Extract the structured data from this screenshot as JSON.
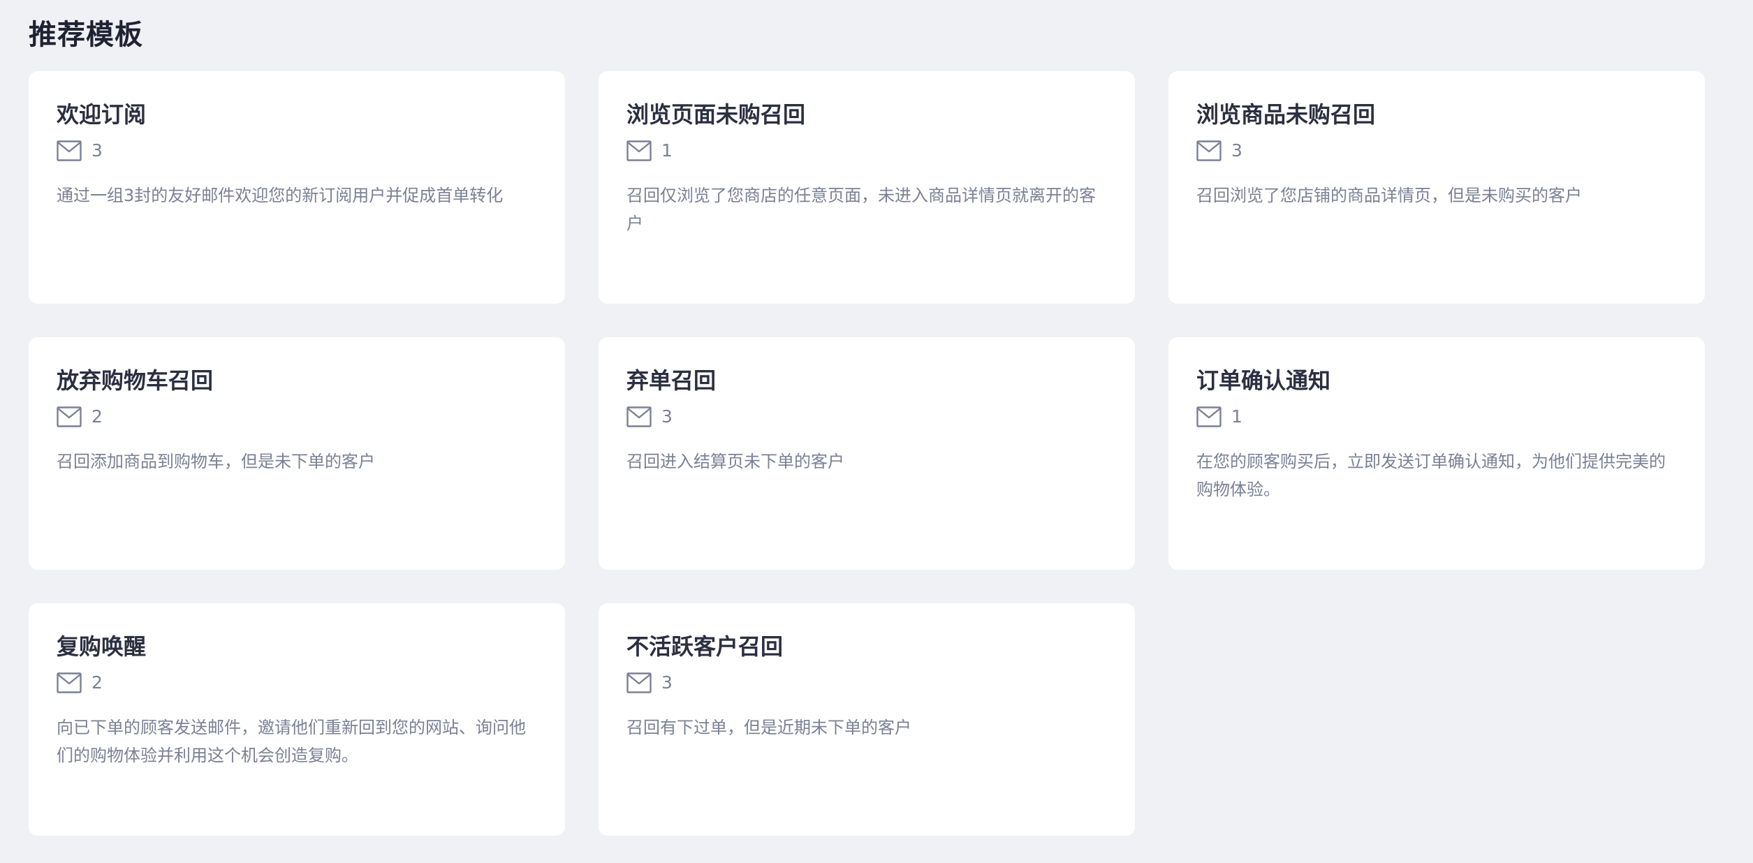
{
  "page": {
    "title": "推荐模板"
  },
  "templates": [
    {
      "title": "欢迎订阅",
      "count": "3",
      "description": "通过一组3封的友好邮件欢迎您的新订阅用户并促成首单转化"
    },
    {
      "title": "浏览页面未购召回",
      "count": "1",
      "description": "召回仅浏览了您商店的任意页面，未进入商品详情页就离开的客户"
    },
    {
      "title": "浏览商品未购召回",
      "count": "3",
      "description": "召回浏览了您店铺的商品详情页，但是未购买的客户"
    },
    {
      "title": "放弃购物车召回",
      "count": "2",
      "description": "召回添加商品到购物车，但是未下单的客户"
    },
    {
      "title": "弃单召回",
      "count": "3",
      "description": "召回进入结算页未下单的客户"
    },
    {
      "title": "订单确认通知",
      "count": "1",
      "description": "在您的顾客购买后，立即发送订单确认通知，为他们提供完美的购物体验。"
    },
    {
      "title": "复购唤醒",
      "count": "2",
      "description": "向已下单的顾客发送邮件，邀请他们重新回到您的网站、询问他们的购物体验并利用这个机会创造复购。"
    },
    {
      "title": "不活跃客户召回",
      "count": "3",
      "description": "召回有下过单，但是近期未下单的客户"
    }
  ],
  "icons": {
    "count_icon": "mail-icon"
  },
  "colors": {
    "background": "#f0f1f5",
    "card": "#ffffff",
    "title": "#2b2f40",
    "muted": "#7a8096"
  }
}
